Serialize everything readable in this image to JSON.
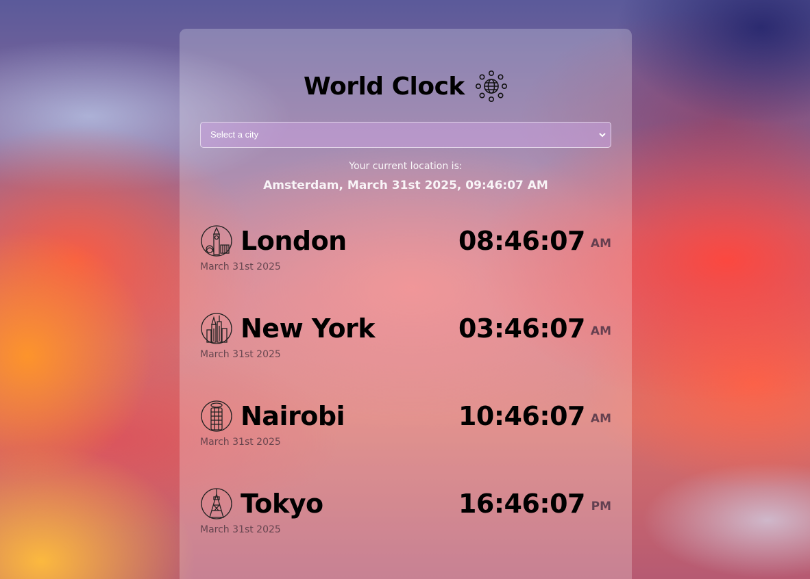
{
  "app": {
    "title": "World Clock",
    "title_icon": "globe-network-icon"
  },
  "city_select": {
    "selected": "Select a city"
  },
  "current_location": {
    "label": "Your current location is:",
    "value": "Amsterdam, March 31st 2025, 09:46:07 AM"
  },
  "cities": [
    {
      "name": "London",
      "date": "March 31st 2025",
      "time": "08:46:07",
      "ampm": "AM",
      "icon": "big-ben-icon"
    },
    {
      "name": "New York",
      "date": "March 31st 2025",
      "time": "03:46:07",
      "ampm": "AM",
      "icon": "skyline-icon"
    },
    {
      "name": "Nairobi",
      "date": "March 31st 2025",
      "time": "10:46:07",
      "ampm": "AM",
      "icon": "tower-building-icon"
    },
    {
      "name": "Tokyo",
      "date": "March 31st 2025",
      "time": "16:46:07",
      "ampm": "PM",
      "icon": "tokyo-tower-icon"
    }
  ]
}
